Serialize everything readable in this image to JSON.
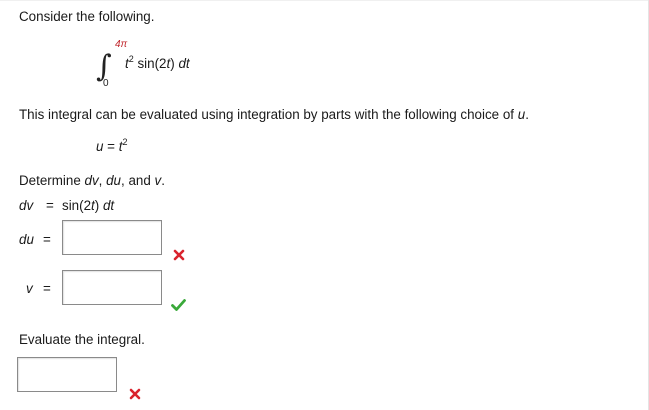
{
  "prompt": "Consider the following.",
  "integral": {
    "upper_limit": "4π",
    "lower_limit": "0",
    "base": "t",
    "exponent": "2",
    "rest": "sin(2",
    "var": "t",
    "close": ")",
    "differential": "dt"
  },
  "parts_text": {
    "before": "This integral can be evaluated using integration by parts with the following choice of ",
    "var": "u",
    "after": "."
  },
  "u_choice": {
    "lhs": "u",
    "eq": " = ",
    "base": "t",
    "exponent": "2"
  },
  "determine_text": {
    "before": "Determine ",
    "dv": "dv",
    "sep1": ", ",
    "du": "du",
    "sep2": ", and ",
    "v": "v",
    "after": "."
  },
  "dv_line": {
    "label": "dv",
    "eq": "=",
    "value_pre": "sin(2",
    "value_var": "t",
    "value_post": ")",
    "value_diff": "dt"
  },
  "du_field": {
    "label": "du",
    "eq": "=",
    "value": "",
    "status": "incorrect"
  },
  "v_field": {
    "label": "v",
    "eq": "=",
    "value": "",
    "status": "correct"
  },
  "evaluate_text": "Evaluate the integral.",
  "answer_field": {
    "value": "",
    "status": "incorrect"
  },
  "colors": {
    "incorrect": "#d9232d",
    "correct": "#3aa93a",
    "limit_upper": "#c1272d"
  },
  "icons": {
    "incorrect": "x-mark-icon",
    "correct": "check-mark-icon"
  }
}
